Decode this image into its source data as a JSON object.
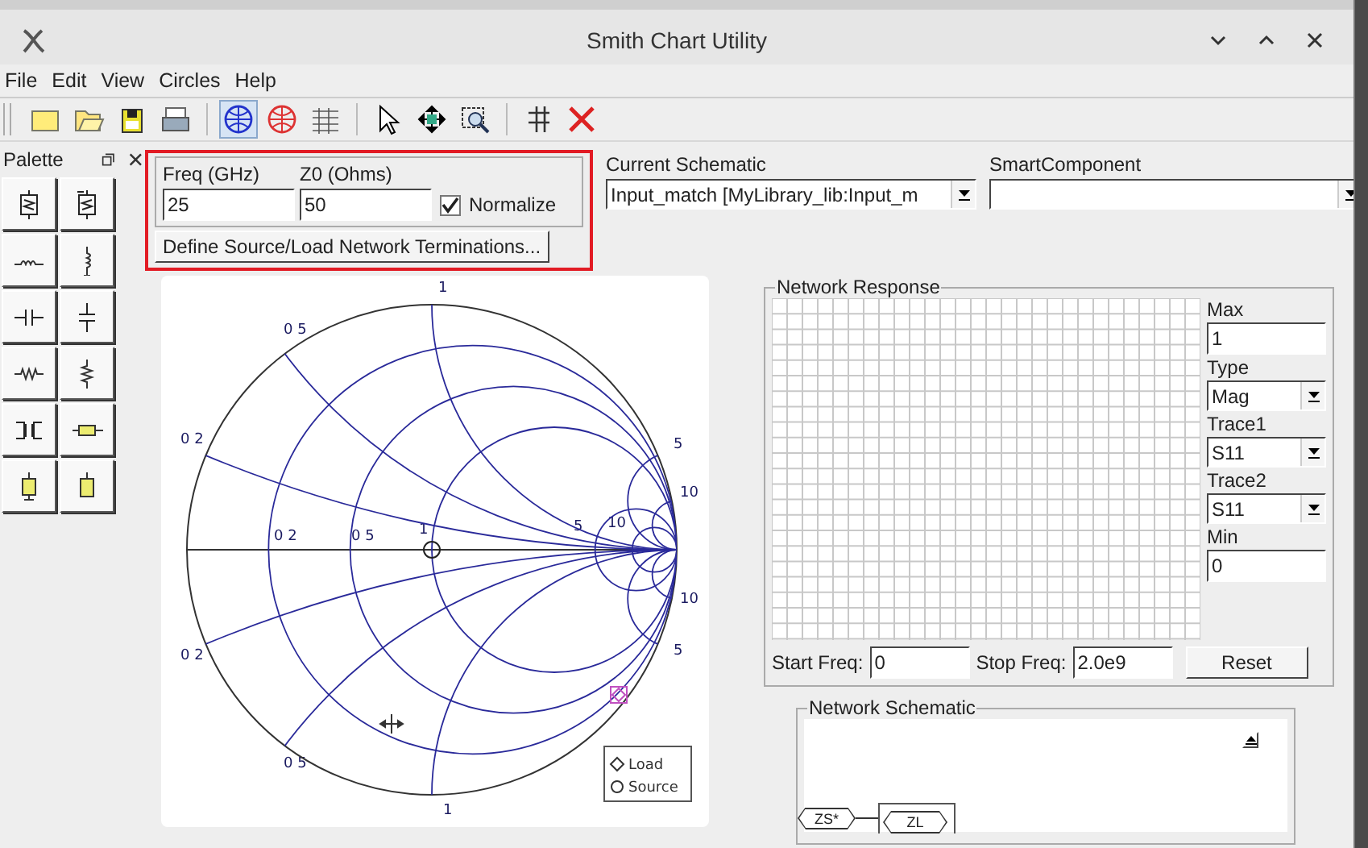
{
  "window": {
    "title": "Smith Chart Utility"
  },
  "menu": [
    {
      "label": "File"
    },
    {
      "label": "Edit"
    },
    {
      "label": "View"
    },
    {
      "label": "Circles"
    },
    {
      "label": "Help"
    }
  ],
  "toolbar": {
    "groups": [
      [
        {
          "kind": "new_file",
          "selected": false
        },
        {
          "kind": "open_file",
          "selected": false
        },
        {
          "kind": "save",
          "selected": false
        },
        {
          "kind": "print",
          "selected": false
        }
      ],
      [
        {
          "kind": "smith_z",
          "selected": true
        },
        {
          "kind": "smith_y",
          "selected": false
        },
        {
          "kind": "table",
          "selected": false
        }
      ],
      [
        {
          "kind": "pointer",
          "selected": false
        },
        {
          "kind": "move",
          "selected": false
        },
        {
          "kind": "zoom",
          "selected": false
        }
      ],
      [
        {
          "kind": "grid",
          "selected": false
        },
        {
          "kind": "delete",
          "selected": false
        }
      ]
    ]
  },
  "palette": {
    "title": "Palette",
    "items": [
      {
        "kind": "series_block"
      },
      {
        "kind": "shunt_block"
      },
      {
        "kind": "series_inductor"
      },
      {
        "kind": "shunt_inductor"
      },
      {
        "kind": "series_capacitor"
      },
      {
        "kind": "shunt_capacitor"
      },
      {
        "kind": "series_resistor"
      },
      {
        "kind": "shunt_resistor"
      },
      {
        "kind": "transformer"
      },
      {
        "kind": "series_line"
      },
      {
        "kind": "short_stub"
      },
      {
        "kind": "open_stub"
      }
    ]
  },
  "parameters": {
    "freq": {
      "label": "Freq (GHz)",
      "value": "25"
    },
    "z0": {
      "label": "Z0 (Ohms)",
      "value": "50"
    },
    "normalize": {
      "label": "Normalize",
      "checked": true
    },
    "terminations_button": "Define Source/Load Network Terminations..."
  },
  "current_schematic": {
    "label": "Current Schematic",
    "value": "Input_match [MyLibrary_lib:Input_m"
  },
  "smart_component": {
    "label": "SmartComponent"
  },
  "smith_chart": {
    "labels": [
      "1",
      "0 5",
      "0 2",
      "0 2",
      "0 5",
      "1",
      "5",
      "10",
      "5",
      "10",
      "10",
      "5",
      "0 2",
      "0 5",
      "1"
    ],
    "legend": [
      "Load",
      "Source"
    ]
  },
  "network_response": {
    "title": "Network Response",
    "max": {
      "label": "Max",
      "value": "1"
    },
    "type": {
      "label": "Type",
      "value": "Mag"
    },
    "trace1": {
      "label": "Trace1",
      "value": "S11"
    },
    "trace2": {
      "label": "Trace2",
      "value": "S11"
    },
    "min": {
      "label": "Min",
      "value": "0"
    },
    "start_freq": {
      "label": "Start Freq:",
      "value": "0"
    },
    "stop_freq": {
      "label": "Stop Freq:",
      "value": "2.0e9"
    },
    "reset_button": "Reset"
  },
  "network_schematic": {
    "title": "Network Schematic",
    "source_label": "ZS*",
    "load_label": "ZL"
  }
}
